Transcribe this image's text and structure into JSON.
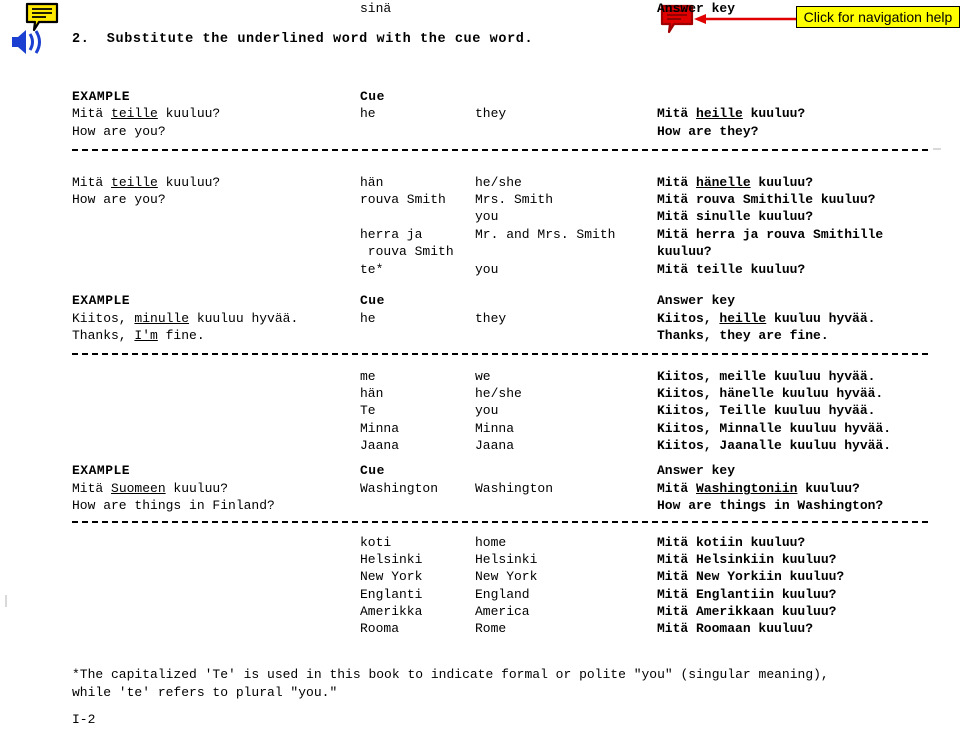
{
  "document": {
    "heading": "2.  Substitute the underlined word with the cue word.",
    "page_number": "I-2",
    "footnote_line1": "*The capitalized 'Te' is used in this book to indicate formal or polite \"you\" (singular meaning),",
    "footnote_line2": "while 'te' refers to plural \"you.\""
  },
  "icons": {
    "speech_bubble": "speech-bubble-icon",
    "speaker": "audio-speaker-icon",
    "red_speech_bubble": "red-speech-bubble-icon",
    "arrow": "left-arrow-icon"
  },
  "nav_help": {
    "label": "Click for navigation help",
    "bg_color": "#ffff00",
    "border_color": "#000000",
    "arrow_color": "#e00000",
    "bubble_color": "#e00000"
  },
  "colors": {
    "icon_yellow": "#ffe800",
    "icon_blue": "#1b3fd0",
    "text": "#000000",
    "page_bg": "#ffffff"
  },
  "column_headers": {
    "example": "EXAMPLE",
    "cue": "Cue",
    "answer_key": "Answer key"
  },
  "sections": [
    {
      "id": "section-1",
      "example": {
        "source_line1_pre": "Mitä ",
        "source_line1_underlined": "teille",
        "source_line1_post": " kuuluu?",
        "source_line2": "How are you?",
        "cue1": "he",
        "cue2": "they",
        "answer_line1_pre": "Mitä ",
        "answer_line1_underlined": "heille",
        "answer_line1_post": " kuuluu?",
        "answer_line2": "How are they?"
      },
      "prompt": {
        "line1_pre": "Mitä ",
        "line1_underlined": "teille",
        "line1_post": " kuuluu?",
        "line2": "How are you?"
      },
      "rows": [
        {
          "cue_fi": "hän",
          "cue_en": "he/she",
          "answer": "Mitä hänelle kuuluu?",
          "answer_underline": "hänelle"
        },
        {
          "cue_fi": "rouva Smith",
          "cue_en": "Mrs. Smith",
          "answer": "Mitä rouva Smithille kuuluu?",
          "answer_underline": ""
        },
        {
          "cue_fi": "sinä",
          "cue_en": "you",
          "answer": "Mitä sinulle kuuluu?",
          "answer_underline": ""
        },
        {
          "cue_fi": "herra ja",
          "cue_en": "Mr. and Mrs. Smith",
          "answer": "Mitä herra ja rouva Smithille",
          "answer_underline": ""
        },
        {
          "cue_fi": " rouva Smith",
          "cue_en": "",
          "answer": "kuuluu?",
          "answer_underline": ""
        },
        {
          "cue_fi": "te*",
          "cue_en": "you",
          "answer": "Mitä teille kuuluu?",
          "answer_underline": ""
        }
      ]
    },
    {
      "id": "section-2",
      "example": {
        "source_line1_pre": "Kiitos, ",
        "source_line1_underlined": "minulle",
        "source_line1_post": " kuuluu hyvää.",
        "source_line2_pre": "Thanks, ",
        "source_line2_underlined": "I'm",
        "source_line2_post": " fine.",
        "cue1": "he",
        "cue2": "they",
        "answer_line1_pre": "Kiitos, ",
        "answer_line1_underlined": "heille",
        "answer_line1_post": " kuuluu hyvää.",
        "answer_line2": "Thanks, they are fine."
      },
      "rows": [
        {
          "cue_fi": "me",
          "cue_en": "we",
          "answer": "Kiitos, meille kuuluu hyvää."
        },
        {
          "cue_fi": "hän",
          "cue_en": "he/she",
          "answer": "Kiitos, hänelle kuuluu hyvää."
        },
        {
          "cue_fi": "Te",
          "cue_en": "you",
          "answer": "Kiitos, Teille kuuluu hyvää."
        },
        {
          "cue_fi": "Minna",
          "cue_en": "Minna",
          "answer": "Kiitos, Minnalle kuuluu hyvää."
        },
        {
          "cue_fi": "Jaana",
          "cue_en": "Jaana",
          "answer": "Kiitos, Jaanalle kuuluu hyvää."
        }
      ]
    },
    {
      "id": "section-3",
      "example": {
        "source_line1_pre": "Mitä ",
        "source_line1_underlined": "Suomeen",
        "source_line1_post": " kuuluu?",
        "source_line2": "How are things in Finland?",
        "cue1": "Washington",
        "cue2": "Washington",
        "answer_line1_pre": "Mitä ",
        "answer_line1_underlined": "Washingtoniin",
        "answer_line1_post": " kuuluu?",
        "answer_line2": "How are things in Washington?"
      },
      "rows": [
        {
          "cue_fi": "koti",
          "cue_en": "home",
          "answer": "Mitä kotiin kuuluu?"
        },
        {
          "cue_fi": "Helsinki",
          "cue_en": "Helsinki",
          "answer": "Mitä Helsinkiin kuuluu?"
        },
        {
          "cue_fi": "New York",
          "cue_en": "New York",
          "answer": "Mitä New Yorkiin kuuluu?"
        },
        {
          "cue_fi": "Englanti",
          "cue_en": "England",
          "answer": "Mitä Englantiin kuuluu?"
        },
        {
          "cue_fi": "Amerikka",
          "cue_en": "America",
          "answer": "Mitä Amerikkaan kuuluu?"
        },
        {
          "cue_fi": "Rooma",
          "cue_en": "Rome",
          "answer": "Mitä Roomaan kuuluu?"
        }
      ]
    }
  ]
}
